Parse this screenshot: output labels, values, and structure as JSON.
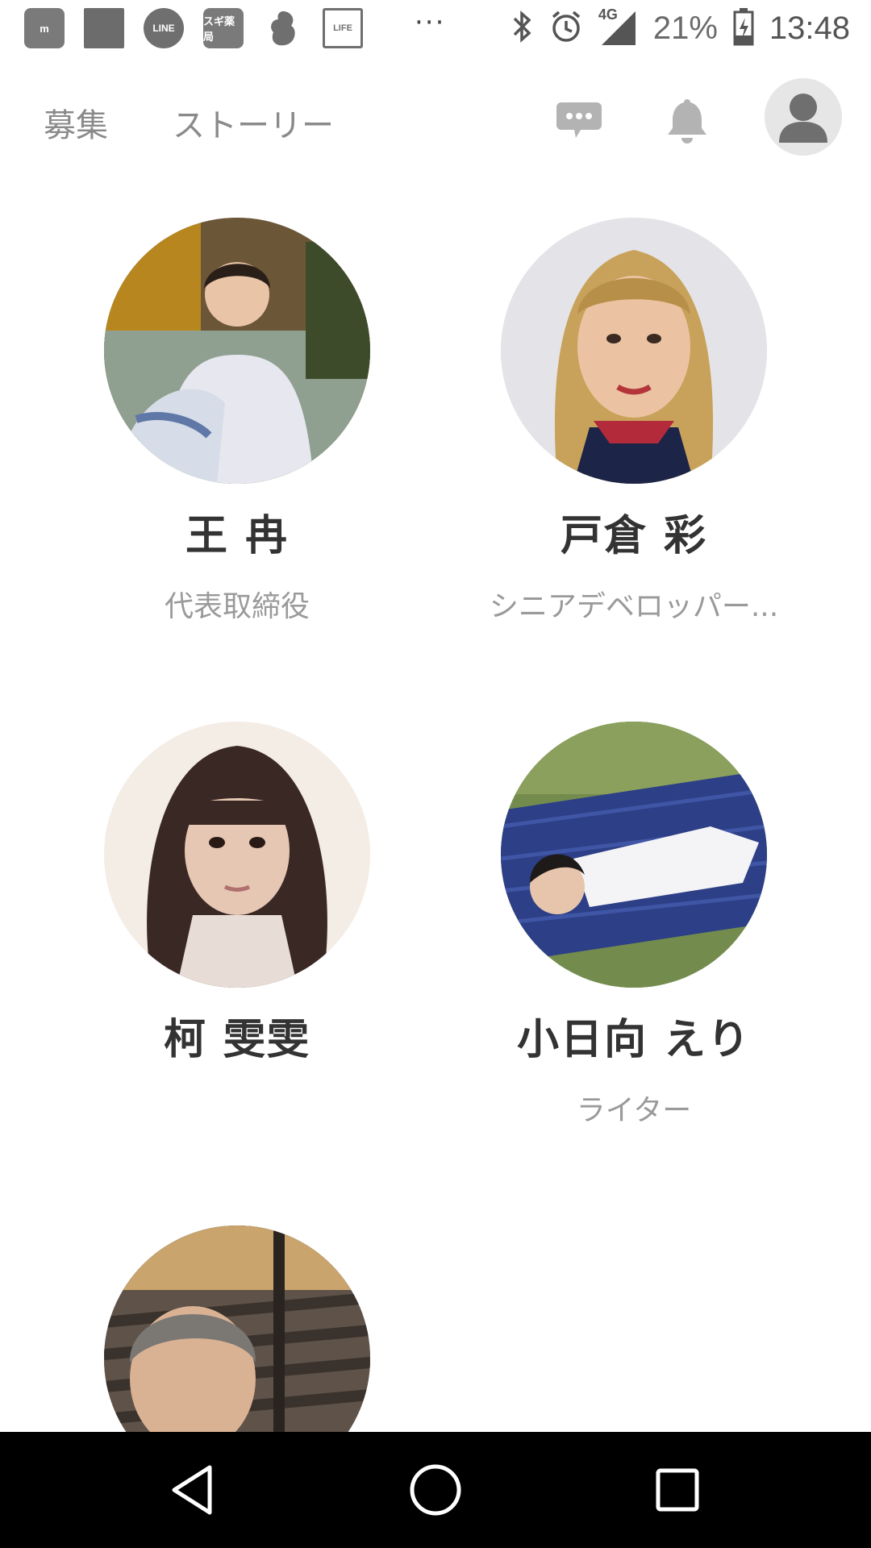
{
  "status_bar": {
    "left_icons": [
      {
        "name": "m-app-icon",
        "label": "m"
      },
      {
        "name": "gray-square-icon",
        "label": ""
      },
      {
        "name": "line-app-icon",
        "label": "LINE"
      },
      {
        "name": "sugi-pharmacy-icon",
        "label": "スギ薬局"
      },
      {
        "name": "squirrel-app-icon",
        "label": ""
      },
      {
        "name": "life-news-icon",
        "label": "LIFE"
      }
    ],
    "overflow": "···",
    "network": "4G",
    "battery": "21%",
    "time": "13:48"
  },
  "header": {
    "tabs": [
      "募集",
      "ストーリー"
    ],
    "icons": [
      "chat-bubble-icon",
      "bell-icon",
      "profile-avatar-icon"
    ]
  },
  "members": [
    {
      "name": "王 冉",
      "role": "代表取締役"
    },
    {
      "name": "戸倉 彩",
      "role": "シニアデベロッパー..."
    },
    {
      "name": "柯 雯雯",
      "role": ""
    },
    {
      "name": "小日向 えり",
      "role": "ライター"
    },
    {
      "name": "",
      "role": ""
    }
  ],
  "colors": {
    "tab_text": "#8a8a8a",
    "name_text": "#333333",
    "role_text": "#9a9a9a",
    "header_icon": "#b3b3b3",
    "nav_bar": "#000000"
  }
}
